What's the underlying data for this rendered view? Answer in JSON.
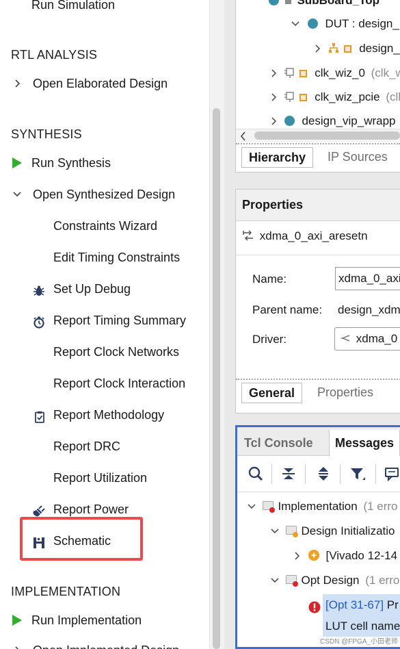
{
  "flow_navigator": {
    "run_simulation": "Run Simulation",
    "rtl_analysis": {
      "heading": "RTL ANALYSIS",
      "open_elaborated": "Open Elaborated Design"
    },
    "synthesis": {
      "heading": "SYNTHESIS",
      "run_synthesis": "Run Synthesis",
      "open_synthesized": "Open Synthesized Design",
      "items": [
        "Constraints Wizard",
        "Edit Timing Constraints",
        "Set Up Debug",
        "Report Timing Summary",
        "Report Clock Networks",
        "Report Clock Interaction",
        "Report Methodology",
        "Report DRC",
        "Report Utilization",
        "Report Power",
        "Schematic"
      ]
    },
    "implementation": {
      "heading": "IMPLEMENTATION",
      "run_implementation": "Run Implementation",
      "open_implemented": "Open Implemented Design"
    },
    "highlight_color": "#ec4a4f",
    "run_icon_color": "#2fae2f"
  },
  "sources": {
    "tree": {
      "top": "SubBoard_Top",
      "dut_name": "DUT : design_",
      "design_child": "design_",
      "clk_wiz_0": "clk_wiz_0",
      "clk_wiz_0_type": "(clk_w",
      "clk_wiz_pcie": "clk_wiz_pcie",
      "clk_wiz_pcie_type": "(clk",
      "design_vip": "design_vip_wrapp"
    },
    "tabs": {
      "hierarchy": "Hierarchy",
      "ip_sources": "IP Sources"
    }
  },
  "properties": {
    "title": "Properties",
    "object_name": "xdma_0_axi_aresetn",
    "name_label": "Name:",
    "name_value": "xdma_0_axi",
    "parent_label": "Parent name:",
    "parent_value": "design_xdm",
    "driver_label": "Driver:",
    "driver_value": "xdma_0",
    "tabs": {
      "general": "General",
      "properties": "Properties"
    }
  },
  "messages": {
    "tabs": {
      "tcl_console": "Tcl Console",
      "messages": "Messages"
    },
    "toolbar": [
      "search-icon",
      "collapse-all-icon",
      "expand-all-icon",
      "filter-icon",
      "comment-icon"
    ],
    "tree": {
      "implementation": "Implementation",
      "implementation_count": "(1 erro",
      "design_init": "Design Initializatio",
      "vivado_msg": "[Vivado 12-14",
      "opt_design": "Opt Design",
      "opt_design_count": "(1 erro",
      "opt_link": "[Opt 31-67]",
      "opt_msg_rest": " Pr",
      "opt_line2": "LUT cell name"
    },
    "accent_color": "#3c6fc9"
  },
  "watermark": "CSDN @FPGA_小田老师"
}
